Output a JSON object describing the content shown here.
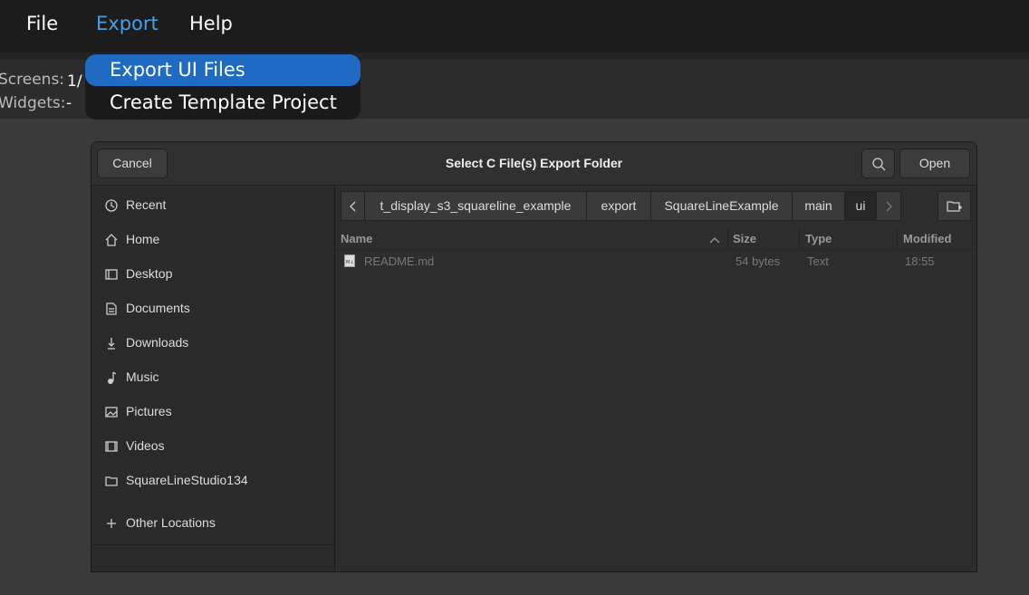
{
  "menubar": {
    "file": "File",
    "export": "Export",
    "help": "Help"
  },
  "infobar": {
    "screens_label": "Screens:",
    "screens_value": "1/",
    "widgets_label": "Widgets:",
    "widgets_value": "-"
  },
  "dropdown": {
    "items": [
      "Export UI Files",
      "Create Template Project"
    ]
  },
  "dialog": {
    "title": "Select C File(s) Export Folder",
    "cancel": "Cancel",
    "open": "Open",
    "sidebar": [
      {
        "label": "Recent",
        "icon": "clock-icon"
      },
      {
        "label": "Home",
        "icon": "home-icon"
      },
      {
        "label": "Desktop",
        "icon": "desktop-icon"
      },
      {
        "label": "Documents",
        "icon": "document-icon"
      },
      {
        "label": "Downloads",
        "icon": "download-icon"
      },
      {
        "label": "Music",
        "icon": "music-icon"
      },
      {
        "label": "Pictures",
        "icon": "picture-icon"
      },
      {
        "label": "Videos",
        "icon": "video-icon"
      },
      {
        "label": "SquareLineStudio134",
        "icon": "folder-icon"
      }
    ],
    "other_locations": "Other Locations",
    "breadcrumbs": [
      "t_display_s3_squareline_example",
      "export",
      "SquareLineExample",
      "main",
      "ui"
    ],
    "columns": {
      "name": "Name",
      "size": "Size",
      "type": "Type",
      "modified": "Modified"
    },
    "files": [
      {
        "name": "README.md",
        "size": "54 bytes",
        "type": "Text",
        "modified": "18:55"
      }
    ]
  },
  "colors": {
    "accent": "#1f6bc4",
    "menu_active": "#4a9fe6"
  }
}
